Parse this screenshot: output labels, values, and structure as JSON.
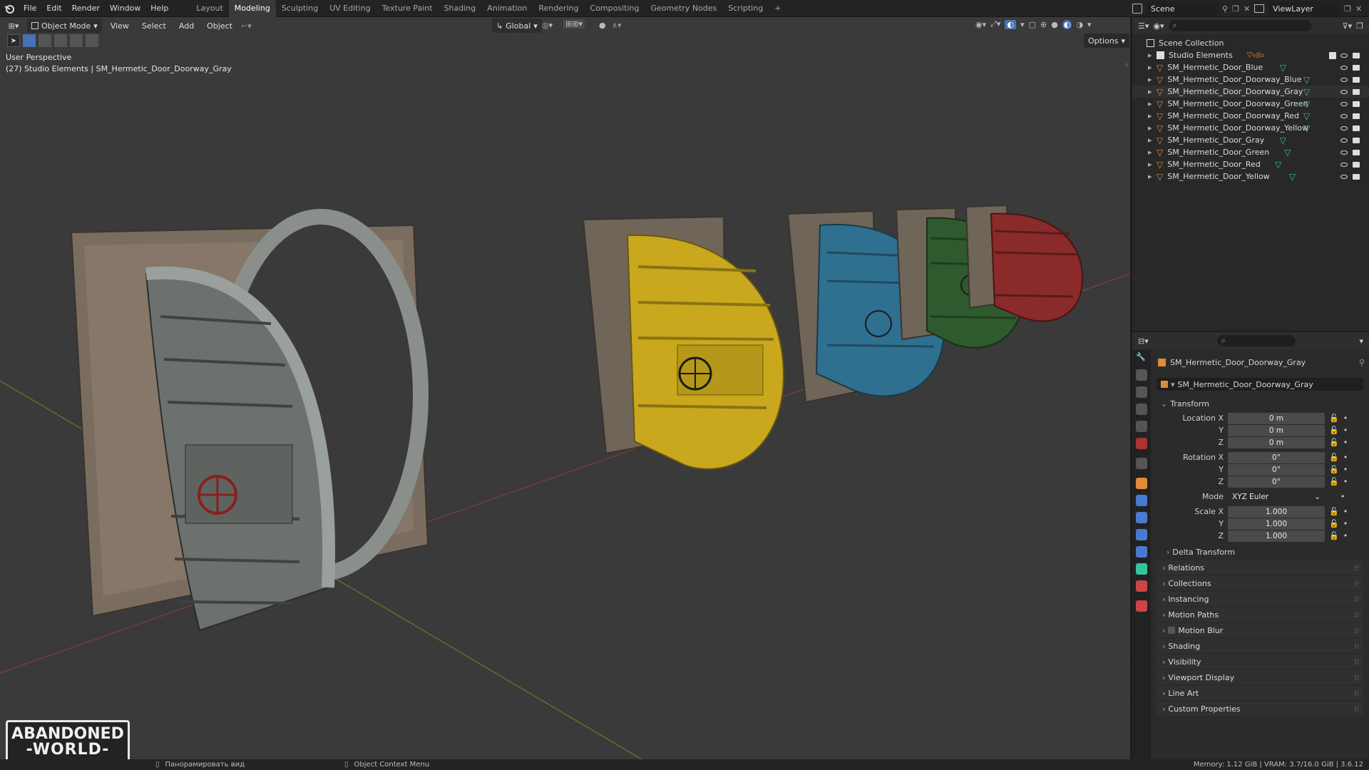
{
  "topbar": {
    "menus": [
      "File",
      "Edit",
      "Render",
      "Window",
      "Help"
    ],
    "workspaces": [
      "Layout",
      "Modeling",
      "Sculpting",
      "UV Editing",
      "Texture Paint",
      "Shading",
      "Animation",
      "Rendering",
      "Compositing",
      "Geometry Nodes",
      "Scripting"
    ],
    "active_workspace": "Modeling",
    "add_tab": "+",
    "scene_label": "Scene",
    "viewlayer_label": "ViewLayer"
  },
  "viewport": {
    "mode": "Object Mode",
    "menus": [
      "View",
      "Select",
      "Add",
      "Object"
    ],
    "orientation": "Global",
    "options_label": "Options",
    "perspective_label": "User Perspective",
    "object_info": "(27) Studio Elements | SM_Hermetic_Door_Doorway_Gray",
    "watermark_line1": "ABANDONED",
    "watermark_line2": "-WORLD-"
  },
  "outliner": {
    "root": "Scene Collection",
    "collection": "Studio Elements",
    "items": [
      "SM_Hermetic_Door_Blue",
      "SM_Hermetic_Door_Doorway_Blue",
      "SM_Hermetic_Door_Doorway_Gray",
      "SM_Hermetic_Door_Doorway_Green",
      "SM_Hermetic_Door_Doorway_Red",
      "SM_Hermetic_Door_Doorway_Yellow",
      "SM_Hermetic_Door_Gray",
      "SM_Hermetic_Door_Green",
      "SM_Hermetic_Door_Red",
      "SM_Hermetic_Door_Yellow"
    ]
  },
  "properties": {
    "object_name": "SM_Hermetic_Door_Doorway_Gray",
    "object_field": "SM_Hermetic_Door_Doorway_Gray",
    "transform_label": "Transform",
    "location_label": "Location X",
    "rotation_label": "Rotation X",
    "scale_label": "Scale X",
    "y_label": "Y",
    "z_label": "Z",
    "mode_label": "Mode",
    "location": [
      "0 m",
      "0 m",
      "0 m"
    ],
    "rotation": [
      "0°",
      "0°",
      "0°"
    ],
    "mode_value": "XYZ Euler",
    "scale": [
      "1.000",
      "1.000",
      "1.000"
    ],
    "delta_transform": "Delta Transform",
    "panels": [
      "Relations",
      "Collections",
      "Instancing",
      "Motion Paths",
      "Motion Blur",
      "Shading",
      "Visibility",
      "Viewport Display",
      "Line Art",
      "Custom Properties"
    ]
  },
  "statusbar": {
    "pan_label": "Панорамировать вид",
    "context_label": "Object Context Menu",
    "stats": "Memory: 1.12 GiB | VRAM: 3.7/16.0 GiB | 3.6.12"
  },
  "colors": {
    "accent": "#4772b3",
    "active_tab": "#3a3a3a",
    "viewport_bg": "#3a3a3a",
    "door_gray": "#8a8f8c",
    "door_yellow": "#c9a81e",
    "door_blue": "#2f6f8f",
    "door_green": "#2e5a2e",
    "door_red": "#8a2a2a",
    "mesh_icon": "#e08a3c",
    "data_icon": "#35c4a0"
  }
}
